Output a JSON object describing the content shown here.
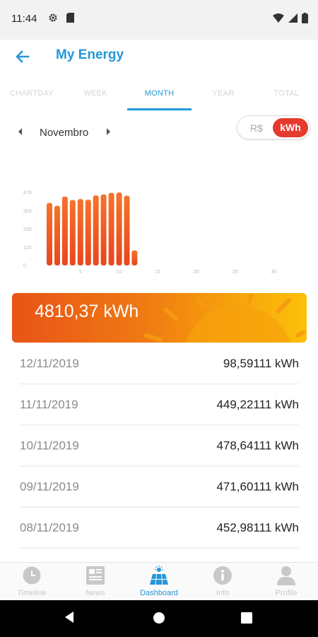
{
  "status_bar": {
    "time": "11:44",
    "icons": [
      "settings-gear-icon",
      "sim-card-icon",
      "wifi-icon",
      "signal-icon",
      "battery-icon"
    ]
  },
  "app_bar": {
    "title": "My Energy",
    "back_icon": "arrow-back-icon"
  },
  "tabs": [
    {
      "label": "CHARTDAY",
      "active": false
    },
    {
      "label": "WEEK",
      "active": false
    },
    {
      "label": "MONTH",
      "active": true
    },
    {
      "label": "YEAR",
      "active": false
    },
    {
      "label": "TOTAL",
      "active": false
    }
  ],
  "period": {
    "label": "Novembro"
  },
  "unit_toggle": {
    "options": [
      "R$",
      "kWh"
    ],
    "selected": "kWh"
  },
  "chart_data": {
    "type": "bar",
    "y_ticks": [
      "479",
      "359",
      "239",
      "120",
      "0"
    ],
    "x_ticks": [
      "5",
      "10",
      "15",
      "20",
      "25",
      "30"
    ],
    "ylim": [
      0,
      479
    ],
    "x": [
      1,
      2,
      3,
      4,
      5,
      6,
      7,
      8,
      9,
      10,
      11,
      12
    ],
    "values": [
      411,
      392,
      452,
      430,
      436,
      432,
      460,
      466,
      477,
      479,
      458,
      99
    ],
    "grid": false
  },
  "total": {
    "value": "4810,37 kWh"
  },
  "days": [
    {
      "date": "12/11/2019",
      "value": "98,59111 kWh"
    },
    {
      "date": "11/11/2019",
      "value": "449,22111 kWh"
    },
    {
      "date": "10/11/2019",
      "value": "478,64111 kWh"
    },
    {
      "date": "09/11/2019",
      "value": "471,60111 kWh"
    },
    {
      "date": "08/11/2019",
      "value": "452,98111 kWh"
    }
  ],
  "bottom_nav": [
    {
      "label": "Timeline",
      "icon": "clock-icon",
      "active": false
    },
    {
      "label": "News",
      "icon": "newspaper-icon",
      "active": false
    },
    {
      "label": "Dashboard",
      "icon": "solar-panel-icon",
      "active": true
    },
    {
      "label": "Info",
      "icon": "info-icon",
      "active": false
    },
    {
      "label": "Profile",
      "icon": "person-icon",
      "active": false
    }
  ],
  "colors": {
    "accent": "#2597d8",
    "toggle_active": "#e53a2e",
    "bar_top": "#f5732a",
    "bar_bottom": "#e8471e",
    "banner_start": "#e95417",
    "banner_end": "#fcc00a"
  }
}
